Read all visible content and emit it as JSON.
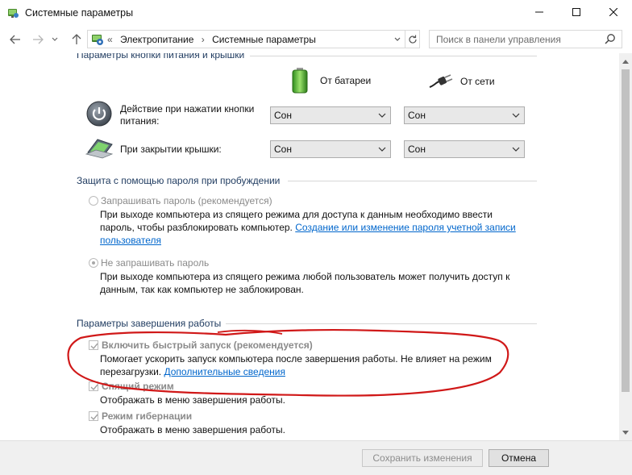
{
  "window": {
    "title": "Системные параметры",
    "icon": "power-options-icon"
  },
  "nav": {
    "breadcrumb_prefix": "«",
    "breadcrumbs": [
      "Электропитание",
      "Системные параметры"
    ],
    "search_placeholder": "Поиск в панели управления"
  },
  "power_buttons": {
    "heading": "Параметры кнопки питания и крышки",
    "col_battery": "От батареи",
    "col_ac": "От сети",
    "rows": [
      {
        "label": "Действие при нажатии кнопки питания:",
        "battery": "Сон",
        "ac": "Сон"
      },
      {
        "label": "При закрытии крышки:",
        "battery": "Сон",
        "ac": "Сон"
      }
    ]
  },
  "password": {
    "heading": "Защита с помощью пароля при пробуждении",
    "require_label": "Запрашивать пароль (рекомендуется)",
    "require_desc": "При выходе компьютера из спящего режима для доступа к данным необходимо ввести пароль, чтобы разблокировать компьютер.",
    "require_link": "Создание или изменение пароля учетной записи пользователя",
    "no_require_label": "Не запрашивать пароль",
    "no_require_desc": "При выходе компьютера из спящего режима любой пользователь может получить доступ к данным, так как компьютер не заблокирован.",
    "selected": "no_require"
  },
  "shutdown": {
    "heading": "Параметры завершения работы",
    "fast_startup_label": "Включить быстрый запуск (рекомендуется)",
    "fast_startup_desc": "Помогает ускорить запуск компьютера после завершения работы. Не влияет на режим перезагрузки.",
    "fast_startup_link": "Дополнительные сведения",
    "sleep_label": "Спящий режим",
    "sleep_desc": "Отображать в меню завершения работы.",
    "hibernate_label": "Режим гибернации",
    "hibernate_desc": "Отображать в меню завершения работы.",
    "fast_startup_checked": true,
    "sleep_checked": true,
    "hibernate_checked": true
  },
  "footer": {
    "save_label": "Сохранить изменения",
    "cancel_label": "Отмена"
  },
  "colors": {
    "link": "#0066cc",
    "section_heading": "#1e3a5f",
    "annotation": "#d01818"
  }
}
